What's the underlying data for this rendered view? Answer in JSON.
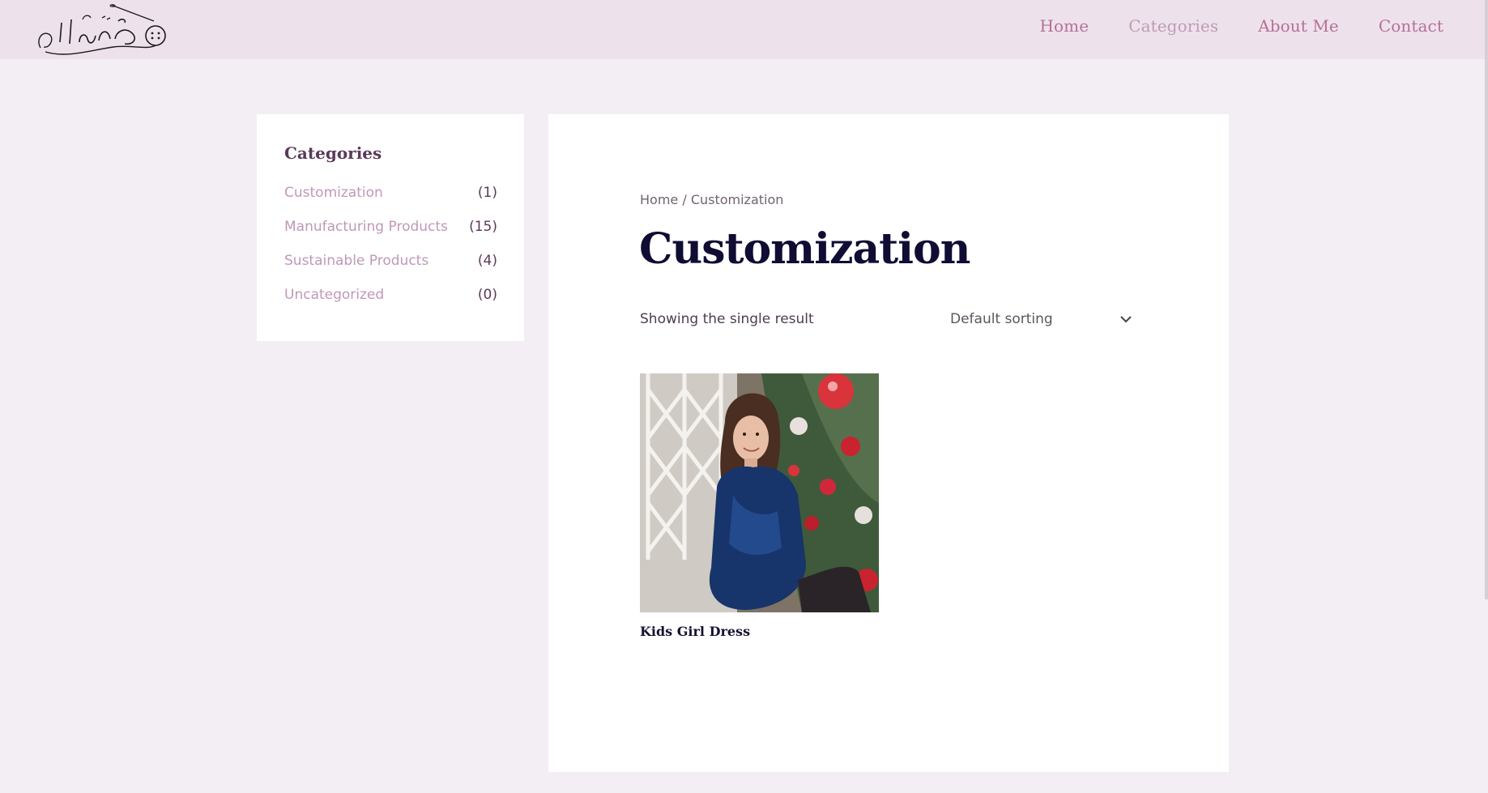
{
  "header": {
    "logo_text": "مشغلنا",
    "nav": [
      {
        "label": "Home"
      },
      {
        "label": "Categories"
      },
      {
        "label": "About Me"
      },
      {
        "label": "Contact"
      }
    ]
  },
  "sidebar": {
    "title": "Categories",
    "categories": [
      {
        "name": "Customization",
        "count": "(1)"
      },
      {
        "name": "Manufacturing Products",
        "count": "(15)"
      },
      {
        "name": "Sustainable Products",
        "count": "(4)"
      },
      {
        "name": "Uncategorized",
        "count": "(0)"
      }
    ]
  },
  "main": {
    "breadcrumb": {
      "home": "Home",
      "separator": " / ",
      "current": "Customization"
    },
    "title": "Customization",
    "result_count": "Showing the single result",
    "sorting": {
      "selected": "Default sorting"
    },
    "products": [
      {
        "name": "Kids Girl Dress",
        "image": "photo-girl-blue-velvet-dress-christmas-tree"
      }
    ]
  },
  "colors": {
    "page_background": "#f3eef4",
    "header_background": "#ede2ec",
    "nav_link": "#b76f98",
    "nav_active": "#c09ab4",
    "title": "#0f0d33",
    "category_link": "#bf98b8"
  }
}
